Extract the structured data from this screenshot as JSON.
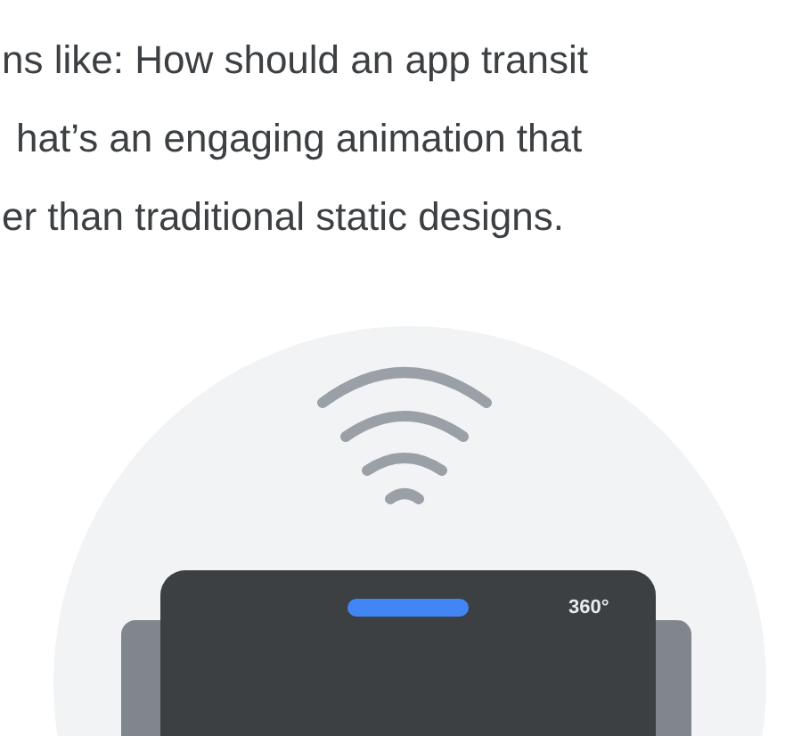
{
  "paragraph_lines": [
    "ns like: How should an app transit",
    "hat’s an engaging animation that",
    "er than traditional static designs."
  ],
  "illustration": {
    "badge": "360°"
  }
}
